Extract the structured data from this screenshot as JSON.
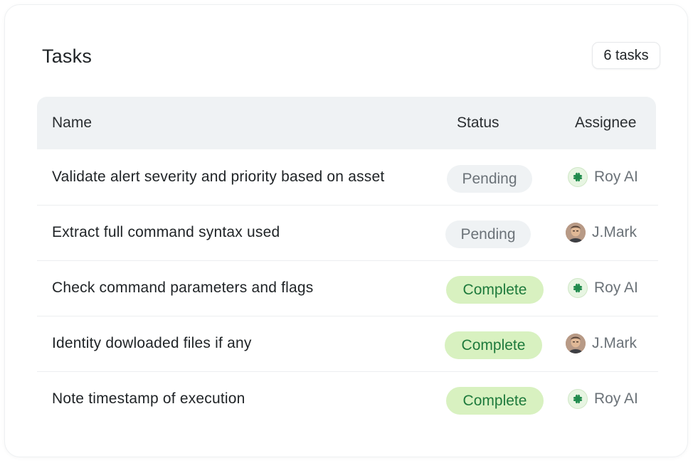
{
  "header": {
    "title": "Tasks",
    "count_label": "6 tasks"
  },
  "table": {
    "columns": {
      "name": "Name",
      "status": "Status",
      "assignee": "Assignee"
    },
    "rows": [
      {
        "name": "Validate alert severity and priority based on asset",
        "status": "Pending",
        "status_type": "pending",
        "assignee": "Roy AI",
        "avatar": "roy-ai-logo"
      },
      {
        "name": "Extract full command syntax used",
        "status": "Pending",
        "status_type": "pending",
        "assignee": "J.Mark",
        "avatar": "person-photo"
      },
      {
        "name": "Check command parameters and flags",
        "status": "Complete",
        "status_type": "complete",
        "assignee": "Roy AI",
        "avatar": "roy-ai-logo"
      },
      {
        "name": "Identity dowloaded files if any",
        "status": "Complete",
        "status_type": "complete",
        "assignee": "J.Mark",
        "avatar": "person-photo"
      },
      {
        "name": "Note timestamp of execution",
        "status": "Complete",
        "status_type": "complete",
        "assignee": "Roy AI",
        "avatar": "roy-ai-logo"
      }
    ]
  },
  "colors": {
    "pending_bg": "#eff2f4",
    "pending_text": "#6b7278",
    "complete_bg": "#d8f1c0",
    "complete_text": "#1e7a3c",
    "ai_logo": "#1f8a4c"
  }
}
